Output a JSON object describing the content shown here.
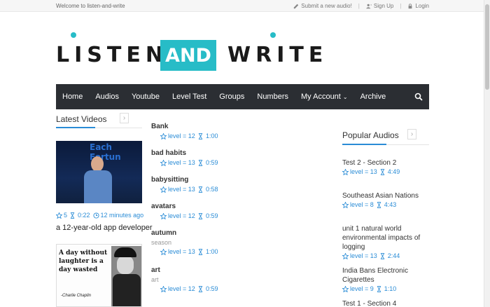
{
  "topbar": {
    "welcome": "Welcome to listen-and-write",
    "submit": "Submit a new audio!",
    "signup": "Sign Up",
    "login": "Login"
  },
  "logo": {
    "part1": "LISTEN",
    "part2": "AND",
    "part3": "WRITE",
    "accent_color": "#27bcc7"
  },
  "nav": {
    "items": [
      "Home",
      "Audios",
      "Youtube",
      "Level Test",
      "Groups",
      "Numbers",
      "My Account",
      "Archive"
    ],
    "account_caret": "⌄",
    "bg_color": "#2b2e33"
  },
  "latest_videos": {
    "title": "Latest Videos",
    "thumb1_text": "Each Fortun",
    "video1": {
      "rating": "5",
      "duration": "0:22",
      "time": "12 minutes ago",
      "caption": "a 12-year-old app developer"
    },
    "thumb2_quote": "A day without laughter is a day wasted",
    "thumb2_author": "-Charlie Chaplin"
  },
  "words": [
    {
      "title": "Bank",
      "sub": "",
      "level": "level = 12",
      "duration": "1:00"
    },
    {
      "title": "bad habits",
      "sub": "",
      "level": "level = 13",
      "duration": "0:59"
    },
    {
      "title": "babysitting",
      "sub": "",
      "level": "level = 13",
      "duration": "0:58"
    },
    {
      "title": "avatars",
      "sub": "",
      "level": "level = 12",
      "duration": "0:59"
    },
    {
      "title": "autumn",
      "sub": "season",
      "level": "level = 13",
      "duration": "1:00"
    },
    {
      "title": "art",
      "sub": "art",
      "level": "level = 12",
      "duration": "0:59"
    }
  ],
  "popular": {
    "title": "Popular Audios",
    "items": [
      {
        "title": "Test 2 - Section 2",
        "level": "level = 13",
        "duration": "4:49"
      },
      {
        "title": "Southeast Asian Nations",
        "level": "level = 8",
        "duration": "4:43"
      },
      {
        "title": "unit 1 natural world environmental impacts of logging",
        "level": "level = 13",
        "duration": "2:44"
      },
      {
        "title": "India Bans Electronic Cigarettes",
        "level": "level = 9",
        "duration": "1:10"
      },
      {
        "title": "Test 1 - Section 4",
        "level": "",
        "duration": ""
      }
    ]
  },
  "colors": {
    "link_blue": "#2a8cd6"
  }
}
